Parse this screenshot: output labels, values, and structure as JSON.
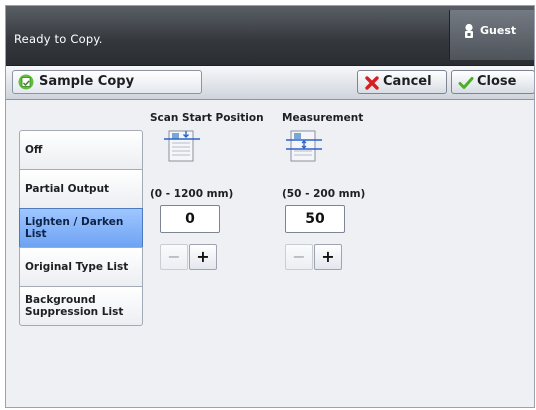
{
  "status": {
    "message": "Ready to Copy.",
    "user_label": "Guest"
  },
  "titlebar": {
    "feature_label": "Sample Copy",
    "cancel_label": "Cancel",
    "close_label": "Close"
  },
  "options": [
    {
      "label": "Off",
      "selected": false
    },
    {
      "label": "Partial Output",
      "selected": false
    },
    {
      "label": "Lighten / Darken List",
      "selected": true
    },
    {
      "label": "Original Type List",
      "selected": false
    },
    {
      "label": "Background Suppression List",
      "selected": false
    }
  ],
  "scan_start": {
    "title": "Scan Start Position",
    "range": "(0 - 1200 mm)",
    "value": "0",
    "minus": "−",
    "plus": "+"
  },
  "measurement": {
    "title": "Measurement",
    "range": "(50 - 200 mm)",
    "value": "50",
    "minus": "−",
    "plus": "+"
  },
  "colors": {
    "selected_option": "#7fb0f8",
    "status_bar": "#3a3e43",
    "cancel_icon": "#d62020",
    "close_icon": "#4caf2a"
  }
}
